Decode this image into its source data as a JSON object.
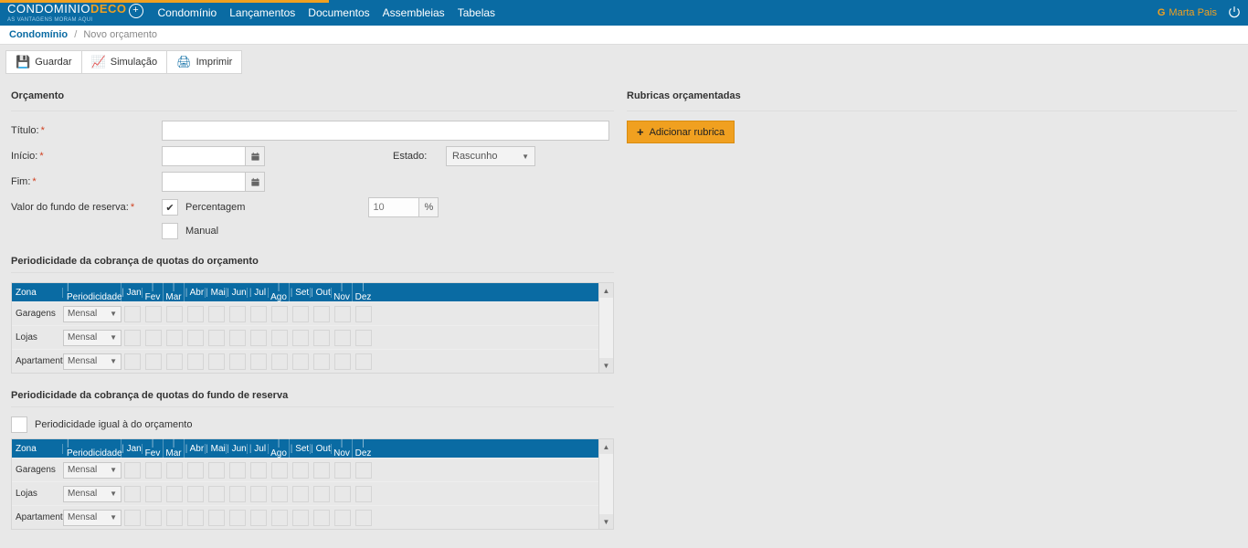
{
  "brand": {
    "name": "CONDOMINIO",
    "deco": "DECO",
    "tagline": "AS VANTAGENS MORAM AQUI"
  },
  "nav": {
    "condominio": "Condomínio",
    "lancamentos": "Lançamentos",
    "documentos": "Documentos",
    "assembleias": "Assembleias",
    "tabelas": "Tabelas"
  },
  "user": {
    "prefix": "G",
    "name": "Marta Pais"
  },
  "breadcrumb": {
    "main": "Condomínio",
    "sub": "Novo orçamento"
  },
  "toolbar": {
    "guardar": "Guardar",
    "simulacao": "Simulação",
    "imprimir": "Imprimir"
  },
  "form": {
    "section": "Orçamento",
    "titulo_label": "Título:",
    "titulo_value": "",
    "inicio_label": "Início:",
    "inicio_value": "",
    "fim_label": "Fim:",
    "fim_value": "",
    "estado_label": "Estado:",
    "estado_value": "Rascunho",
    "valor_label": "Valor do fundo de reserva:",
    "percentagem_label": "Percentagem",
    "manual_label": "Manual",
    "percent_value": "10",
    "percent_sym": "%"
  },
  "months": [
    "Jan",
    "Fev",
    "Mar",
    "Abr",
    "Mai",
    "Jun",
    "Jul",
    "Ago",
    "Set",
    "Out",
    "Nov",
    "Dez"
  ],
  "period1": {
    "title": "Periodicidade da cobrança de quotas do orçamento",
    "zona": "Zona",
    "period": "Periodicidade",
    "rows": [
      {
        "zona": "Garagens",
        "period": "Mensal"
      },
      {
        "zona": "Lojas",
        "period": "Mensal"
      },
      {
        "zona": "Apartamento",
        "period": "Mensal"
      }
    ]
  },
  "period2": {
    "title": "Periodicidade da cobrança de quotas do fundo de reserva",
    "same_label": "Periodicidade igual à do orçamento",
    "zona": "Zona",
    "period": "Periodicidade",
    "rows": [
      {
        "zona": "Garagens",
        "period": "Mensal"
      },
      {
        "zona": "Lojas",
        "period": "Mensal"
      },
      {
        "zona": "Apartamento",
        "period": "Mensal"
      }
    ]
  },
  "rubricas": {
    "title": "Rubricas orçamentadas",
    "add": "Adicionar rubrica"
  }
}
